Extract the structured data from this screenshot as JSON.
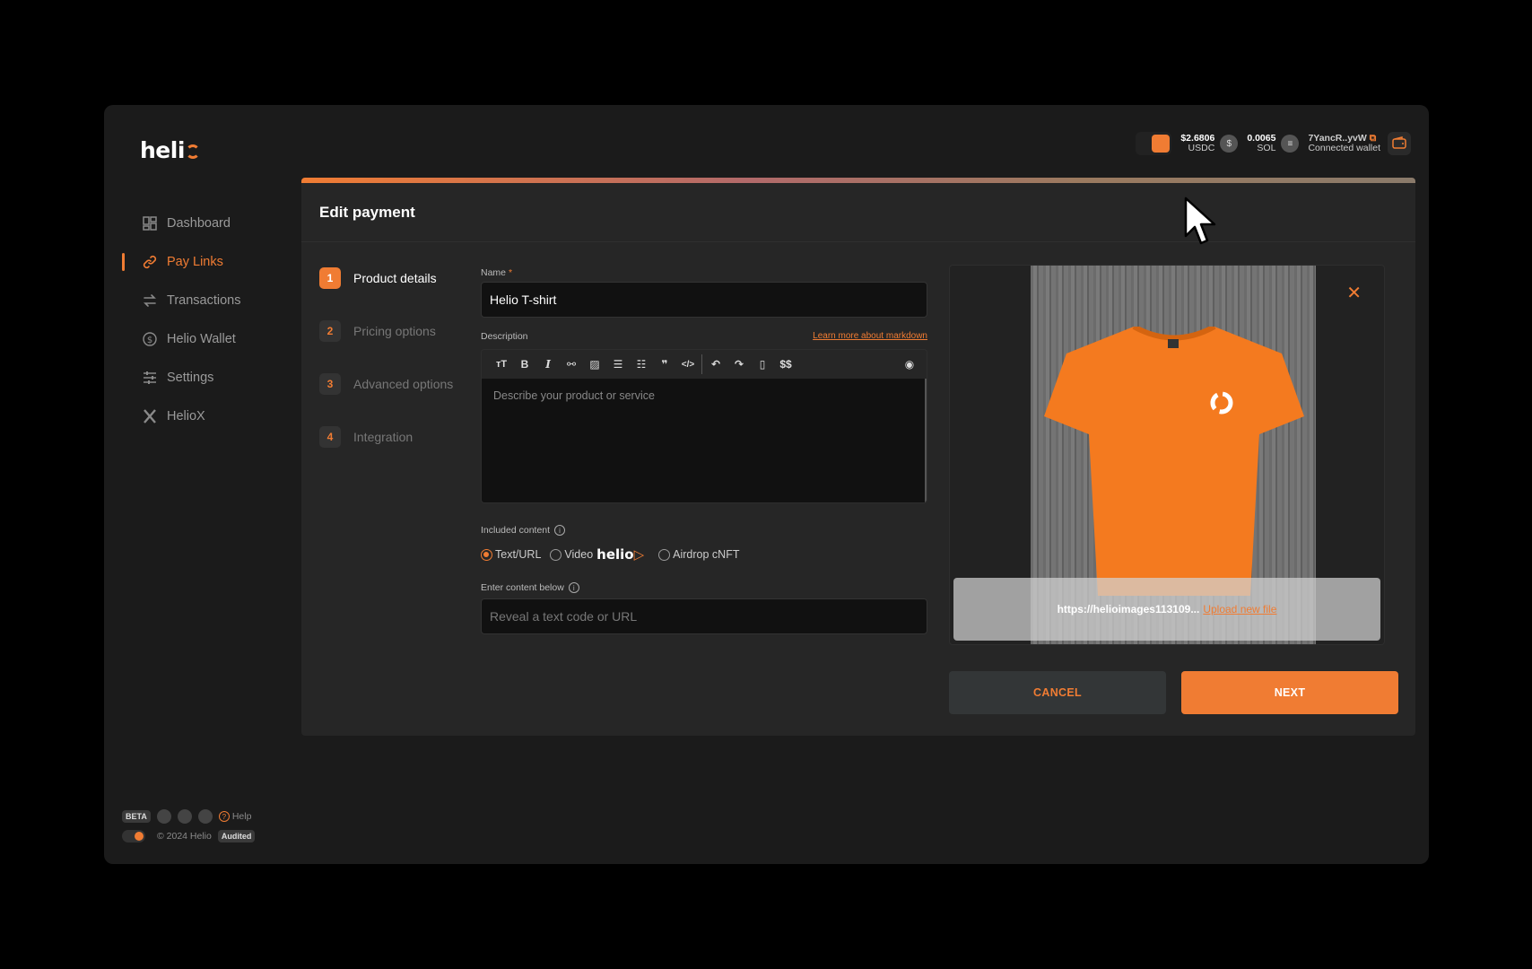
{
  "brand": {
    "logo_text": "heli",
    "accent": "#f07c33"
  },
  "sidebar": {
    "items": [
      {
        "label": "Dashboard",
        "icon": "dashboard-icon"
      },
      {
        "label": "Pay Links",
        "icon": "link-icon",
        "active": true
      },
      {
        "label": "Transactions",
        "icon": "transfer-arrows-icon"
      },
      {
        "label": "Helio Wallet",
        "icon": "dollar-coin-icon"
      },
      {
        "label": "Settings",
        "icon": "sliders-icon"
      },
      {
        "label": "HelioX",
        "icon": "x-icon"
      }
    ],
    "footer": {
      "beta": "BETA",
      "help": "Help",
      "copyright": "© 2024 Helio",
      "audited": "Audited"
    }
  },
  "topbar": {
    "usdc_amount": "$2.6806",
    "usdc_label": "USDC",
    "sol_amount": "0.0065",
    "sol_label": "SOL",
    "wallet_address": "7YancR..yvW",
    "wallet_label": "Connected wallet"
  },
  "panel": {
    "title": "Edit payment",
    "steps": [
      {
        "n": "1",
        "label": "Product details",
        "active": true
      },
      {
        "n": "2",
        "label": "Pricing options"
      },
      {
        "n": "3",
        "label": "Advanced options"
      },
      {
        "n": "4",
        "label": "Integration"
      }
    ],
    "name_label": "Name",
    "name_required": "*",
    "name_value": "Helio T-shirt",
    "description_label": "Description",
    "markdown_link": "Learn more about markdown",
    "description_placeholder": "Describe your product or service",
    "toolbar": [
      "heading",
      "bold",
      "italic",
      "link",
      "image",
      "bullet-list",
      "numbered-list",
      "quote",
      "code",
      "undo",
      "redo",
      "delete",
      "$$",
      "preview"
    ],
    "dollar_label": "$$",
    "included_label": "Included content",
    "radio_options": [
      "Text/URL",
      "Video",
      "Airdrop cNFT"
    ],
    "radio_selected": "Text/URL",
    "video_brand": "helio",
    "content_label": "Enter content below",
    "content_placeholder": "Reveal a text code or URL",
    "image_url": "https://helioimages113109...",
    "upload_link": "Upload new file",
    "cancel_label": "CANCEL",
    "next_label": "NEXT"
  }
}
